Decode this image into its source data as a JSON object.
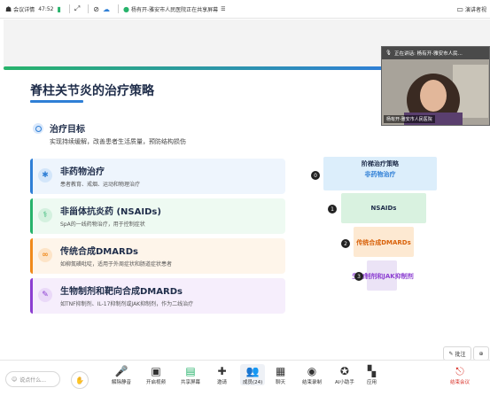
{
  "topbar": {
    "meeting_info": "会议详情",
    "timer": "47:52",
    "sharing_status": "杨有开-雅安市人民医院正在共享屏幕",
    "speaker_view": "演讲者视"
  },
  "slide": {
    "title": "脊柱关节炎的治疗策略",
    "goal_title": "治疗目标",
    "goal_desc": "实现持续缓解，改善患者生活质量，预防结构损伤",
    "cards": [
      {
        "title": "非药物治疗",
        "subtitle": "患者教育、戒烟、运动和物理治疗",
        "icon": "person-icon",
        "color": "#2f7fd6",
        "bg": "#eef5fd"
      },
      {
        "title": "非甾体抗炎药 (NSAIDs)",
        "subtitle": "SpA的一线药物治疗，用于控制症状",
        "icon": "pill-icon",
        "color": "#27b36b",
        "bg": "#eefaf2"
      },
      {
        "title": "传统合成DMARDs",
        "subtitle": "如柳氮磺吡啶，适用于外周症状和肠道症状患者",
        "icon": "pills-icon",
        "color": "#f08a1c",
        "bg": "#fef5ea"
      },
      {
        "title": "生物制剂和靶向合成DMARDs",
        "subtitle": "如TNF抑制剂、IL-17抑制剂或JAK抑制剂，作为二线治疗",
        "icon": "syringe-icon",
        "color": "#8c3fd1",
        "bg": "#f6eefc"
      }
    ],
    "pyramid": {
      "title": "阶梯治疗策略",
      "levels": [
        {
          "badge": "0",
          "label": "非药物治疗",
          "color": "#2f7fd6",
          "bg": "#dceefb"
        },
        {
          "badge": "1",
          "label": "NSAIDs",
          "color": "#1f2d4a",
          "bg": "#d9f2e0"
        },
        {
          "badge": "2",
          "label": "传统合成DMARDs",
          "color": "#d9620b",
          "bg": "#fde9d2"
        },
        {
          "badge": "3",
          "label": "生物制剂和JAK抑制剂",
          "color": "#8c3fd1",
          "bg": "#ebe3f6"
        }
      ]
    }
  },
  "video": {
    "speaking_label": "正在讲话: 杨有开-雅安市人民...",
    "participant_name": "杨有开-雅安市人民医院"
  },
  "floating": {
    "annotate": "批注"
  },
  "toolbar": {
    "chat_placeholder": "说点什么...",
    "items": [
      {
        "label": "解除静音",
        "icon": "mic-muted-icon"
      },
      {
        "label": "开启视频",
        "icon": "camera-off-icon"
      },
      {
        "label": "共享屏幕",
        "icon": "share-screen-icon"
      },
      {
        "label": "邀请",
        "icon": "invite-icon"
      },
      {
        "label": "成员(24)",
        "icon": "members-icon"
      },
      {
        "label": "聊天",
        "icon": "chat-icon"
      },
      {
        "label": "结束录制",
        "icon": "record-icon"
      },
      {
        "label": "AI小助手",
        "icon": "ai-assistant-icon"
      },
      {
        "label": "应用",
        "icon": "apps-icon"
      }
    ],
    "end_meeting": "结束会议"
  }
}
